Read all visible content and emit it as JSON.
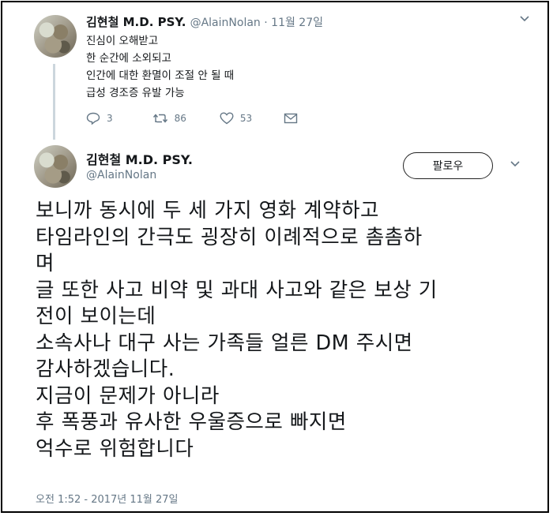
{
  "reply_tweet": {
    "author_name": "김현철 M.D. PSY.",
    "handle": "@AlainNolan",
    "separator": " · ",
    "date": "11월 27일",
    "lines": [
      "진심이 오해받고",
      "한 순간에 소외되고",
      "인간에 대한 환멸이 조절 안 될 때",
      "급성 경조증 유발 가능"
    ],
    "reply_count": "3",
    "retweet_count": "86",
    "like_count": "53"
  },
  "main_tweet": {
    "author_name": "김현철 M.D. PSY.",
    "handle": "@AlainNolan",
    "follow_label": "팔로우",
    "lines": [
      "보니까 동시에 두 세 가지 영화 계약하고",
      "타임라인의 간극도 굉장히 이례적으로 촘촘하",
      "며",
      "글 또한 사고 비약 및 과대 사고와 같은 보상 기",
      "전이 보이는데",
      "소속사나 대구 사는 가족들 얼른 DM 주시면",
      "감사하겠습니다.",
      "지금이 문제가 아니라",
      "후 폭풍과 유사한 우울증으로 빠지면",
      "억수로 위험합니다"
    ],
    "timestamp": "오전 1:52 - 2017년 11월 27일"
  }
}
